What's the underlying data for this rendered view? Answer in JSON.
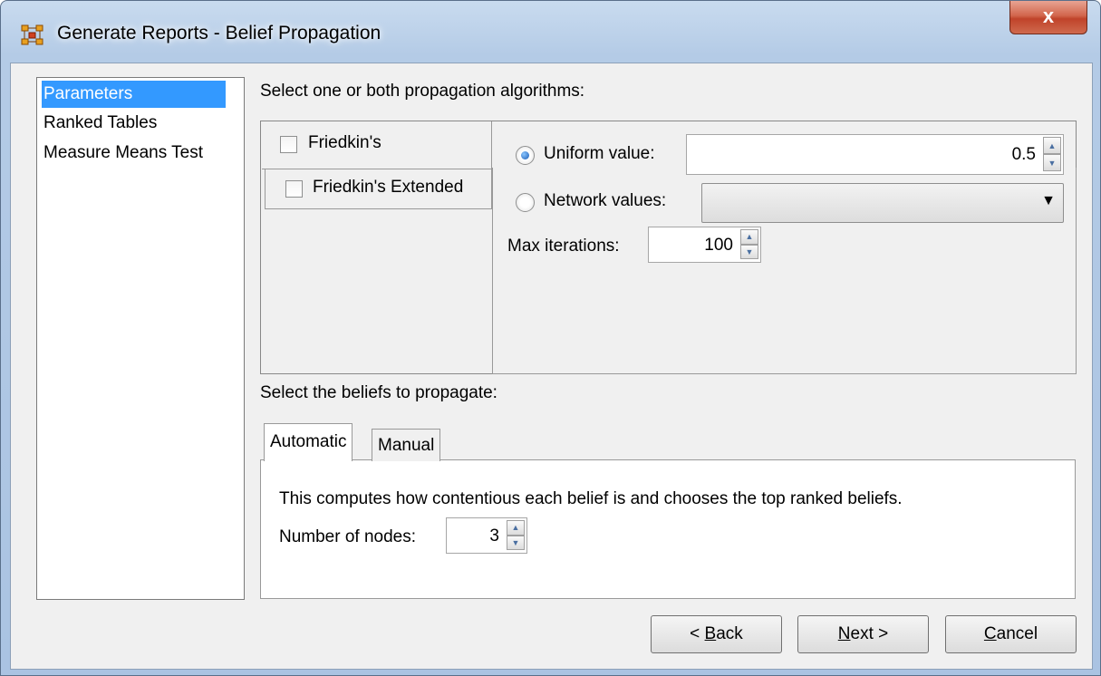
{
  "window": {
    "title": "Generate Reports - Belief Propagation",
    "close_label": "x"
  },
  "nav": {
    "items": [
      {
        "label": "Parameters",
        "selected": true
      },
      {
        "label": "Ranked Tables",
        "selected": false
      },
      {
        "label": "Measure Means Test",
        "selected": false
      }
    ]
  },
  "algorithms": {
    "heading": "Select one or both propagation algorithms:",
    "friedkin_label": "Friedkin's",
    "friedkin_checked": false,
    "friedkin_extended_label": "Friedkin's Extended",
    "friedkin_extended_checked": false,
    "uniform_label": "Uniform value:",
    "uniform_selected": true,
    "uniform_value": "0.5",
    "network_label": "Network values:",
    "network_selected": false,
    "network_value": "",
    "max_iterations_label": "Max iterations:",
    "max_iterations_value": "100"
  },
  "beliefs": {
    "heading": "Select the beliefs to propagate:",
    "tabs": [
      {
        "label": "Automatic",
        "active": true
      },
      {
        "label": "Manual",
        "active": false
      }
    ],
    "description": "This computes how contentious each belief is and chooses the top ranked beliefs.",
    "nodes_label": "Number of nodes:",
    "nodes_value": "3"
  },
  "buttons": {
    "back": {
      "prefix": "< ",
      "mnemonic": "B",
      "rest": "ack"
    },
    "next": {
      "prefix": "",
      "mnemonic": "N",
      "rest": "ext >"
    },
    "cancel": {
      "prefix": "",
      "mnemonic": "C",
      "rest": "ancel"
    }
  },
  "icons": {
    "app": "network-app-icon",
    "close": "close-icon",
    "spin_up": "spin-up-icon",
    "spin_down": "spin-down-icon",
    "dropdown": "chevron-down-icon"
  }
}
